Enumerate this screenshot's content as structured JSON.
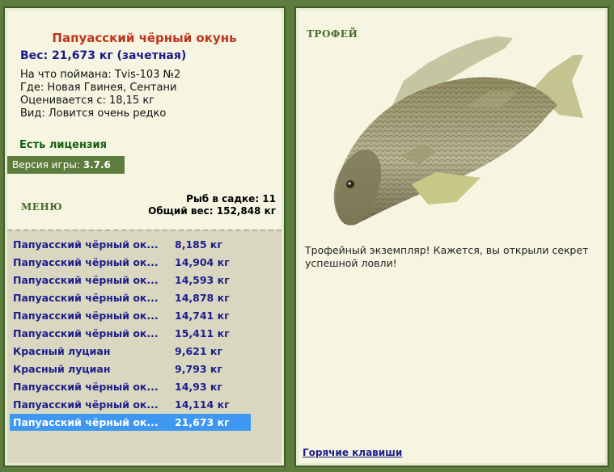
{
  "catch": {
    "title": "Папуасский чёрный окунь",
    "weight": "Вес: 21,673 кг (зачетная)",
    "bait": "На что поймана: Tvis-103 №2",
    "location": "Где: Новая Гвинея, Сентани",
    "valued_from": "Оценивается с: 18,15 кг",
    "rarity": "Вид: Ловится очень редко"
  },
  "license": "Есть лицензия",
  "version": {
    "label": "Версия игры:",
    "value": "3.7.6"
  },
  "menu_label": "МЕНЮ",
  "keepnet": {
    "count": "Рыб в садке: 11",
    "total_weight": "Общий вес: 152,848 кг"
  },
  "fish_list": [
    {
      "name": "Папуасский чёрный ок...",
      "weight": "8,185 кг"
    },
    {
      "name": "Папуасский чёрный ок...",
      "weight": "14,904 кг"
    },
    {
      "name": "Папуасский чёрный ок...",
      "weight": "14,593 кг"
    },
    {
      "name": "Папуасский чёрный ок...",
      "weight": "14,878 кг"
    },
    {
      "name": "Папуасский чёрный ок...",
      "weight": "14,741 кг"
    },
    {
      "name": "Папуасский чёрный ок...",
      "weight": "15,411 кг"
    },
    {
      "name": "Красный луциан",
      "weight": "9,621 кг"
    },
    {
      "name": "Красный луциан",
      "weight": "9,793 кг"
    },
    {
      "name": "Папуасский чёрный ок...",
      "weight": "14,93 кг"
    },
    {
      "name": "Папуасский чёрный ок...",
      "weight": "14,114 кг"
    },
    {
      "name": "Папуасский чёрный ок...",
      "weight": "21,673 кг",
      "selected": true
    }
  ],
  "trophy": {
    "label": "ТРОФЕЙ",
    "text": "Трофейный экземпляр! Кажется, вы открыли секрет успешной ловли!"
  },
  "hotkeys_label": "Горячие клавиши",
  "image": {
    "icon": "fish-image"
  },
  "colors": {
    "frame": "#5d7c3e",
    "panel": "#f5f5e2",
    "list_bg": "#d9d7c0",
    "selection": "#3d97f3",
    "title": "#c0341a",
    "link": "#1e1e8c"
  }
}
